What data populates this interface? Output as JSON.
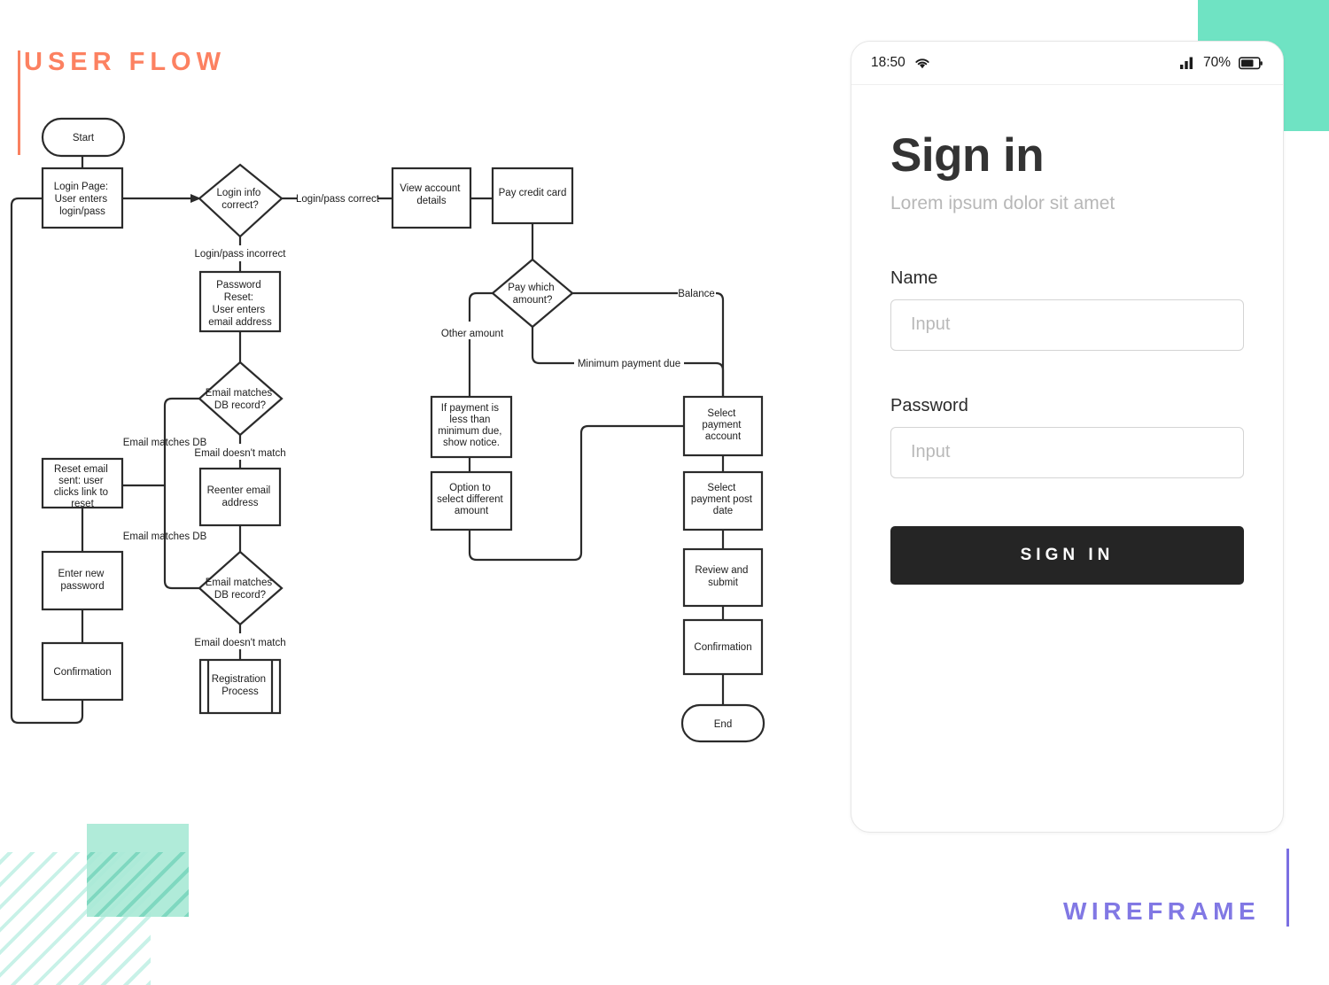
{
  "page": {
    "title": "USER FLOW",
    "brand": "WIREFRAME",
    "accent_orange": "#FC8161",
    "accent_purple": "#8178E4",
    "accent_teal": "#6FE3C3",
    "accent_mint": "#A9E9D6"
  },
  "flow": {
    "nodes": {
      "start": "Start",
      "login_page": "Login Page:\nUser enters\nlogin/pass",
      "login_info_correct": "Login info\ncorrect?",
      "password_reset": "Password\nReset:\nUser enters\nemail address",
      "email_matches_1": "Email matches\nDB record?",
      "reset_email_sent": "Reset email\nsent: user\nclicks link to\nreset",
      "reenter_email": "Reenter email\naddress",
      "enter_new_password": "Enter new\npassword",
      "email_matches_2": "Email matches\nDB record?",
      "confirmation_left": "Confirmation",
      "registration_process": "Registration\nProcess",
      "view_account_details": "View account\ndetails",
      "pay_credit_card": "Pay credit card",
      "pay_which_amount": "Pay which\namount?",
      "less_than_minimum": "If payment is\nless than\nminimum due,\nshow notice.",
      "option_different_amount": "Option to\nselect different\namount",
      "select_payment_account": "Select\npayment\naccount",
      "select_payment_post_date": "Select\npayment post\ndate",
      "review_and_submit": "Review and\nsubmit",
      "confirmation_right": "Confirmation",
      "end": "End"
    },
    "edge_labels": {
      "login_pass_correct": "Login/pass correct",
      "login_pass_incorrect": "Login/pass incorrect",
      "email_matches_db_1": "Email matches DB",
      "email_doesnt_match_1": "Email doesn't match",
      "email_matches_db_2": "Email matches DB",
      "email_doesnt_match_2": "Email doesn't match",
      "balance": "Balance",
      "other_amount": "Other amount",
      "minimum_payment_due": "Minimum payment due"
    }
  },
  "phone": {
    "status": {
      "time": "18:50",
      "wifi_icon": "wifi-icon",
      "signal_icon": "signal-bars-icon",
      "battery_percent": "70%",
      "battery_icon": "battery-icon"
    },
    "screen": {
      "heading": "Sign in",
      "subheading": "Lorem ipsum dolor sit amet",
      "name_label": "Name",
      "name_placeholder": "Input",
      "name_value": "",
      "password_label": "Password",
      "password_placeholder": "Input",
      "password_value": "",
      "submit_label": "SIGN IN"
    }
  }
}
